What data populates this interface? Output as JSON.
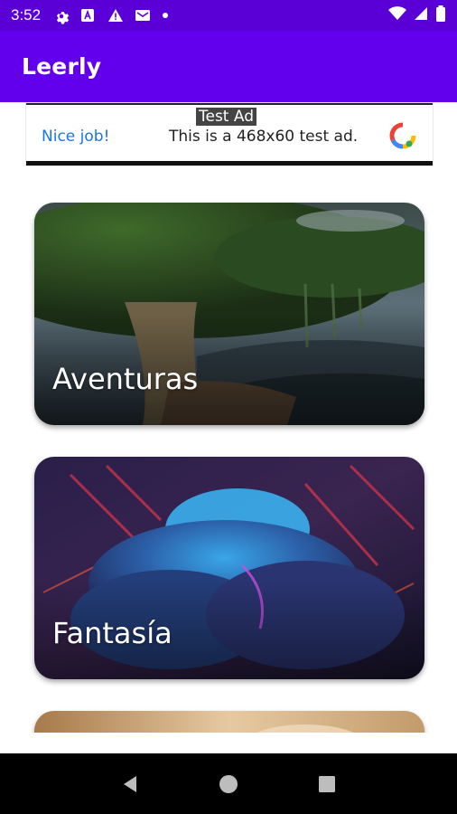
{
  "status_bar": {
    "time": "3:52",
    "icons_left": [
      "gear-icon",
      "font-a-icon",
      "warning-icon",
      "mail-icon",
      "dot-icon"
    ],
    "icons_right": [
      "wifi-icon",
      "signal-icon",
      "battery-icon"
    ]
  },
  "app_bar": {
    "title": "Leerly",
    "color": "#6200ee"
  },
  "ad": {
    "badge": "Test Ad",
    "nice": "Nice job!",
    "text": "This is a 468x60 test ad."
  },
  "categories": [
    {
      "label": "Aventuras",
      "theme": "forest-tree"
    },
    {
      "label": "Fantasía",
      "theme": "nebula-cloud"
    },
    {
      "label": "",
      "theme": "gold-partial"
    }
  ],
  "nav_bar": {
    "buttons": [
      "back-icon",
      "home-icon",
      "recents-icon"
    ]
  }
}
